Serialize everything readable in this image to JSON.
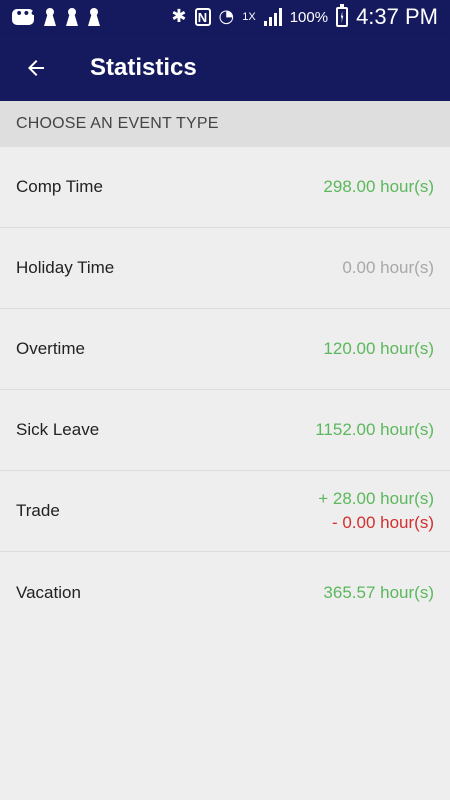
{
  "status_bar": {
    "network_speed": "1X",
    "battery": "100%",
    "time": "4:37 PM"
  },
  "app_bar": {
    "title": "Statistics"
  },
  "section": {
    "header": "CHOOSE AN EVENT TYPE"
  },
  "events": [
    {
      "label": "Comp Time",
      "value": "298.00 hour(s)",
      "color": "#5cb85c"
    },
    {
      "label": "Holiday Time",
      "value": "0.00 hour(s)",
      "color": "#a8a8a8"
    },
    {
      "label": "Overtime",
      "value": "120.00 hour(s)",
      "color": "#5cb85c"
    },
    {
      "label": "Sick Leave",
      "value": "1152.00 hour(s)",
      "color": "#5cb85c"
    },
    {
      "label": "Trade",
      "value_plus": "+ 28.00 hour(s)",
      "value_minus": "- 0.00 hour(s)",
      "color_plus": "#5cb85c",
      "color_minus": "#d32f2f"
    },
    {
      "label": "Vacation",
      "value": "365.57 hour(s)",
      "color": "#5cb85c"
    }
  ],
  "colors": {
    "app_bar": "#151a5e",
    "background": "#eeeeee",
    "section_header": "#dedede"
  }
}
